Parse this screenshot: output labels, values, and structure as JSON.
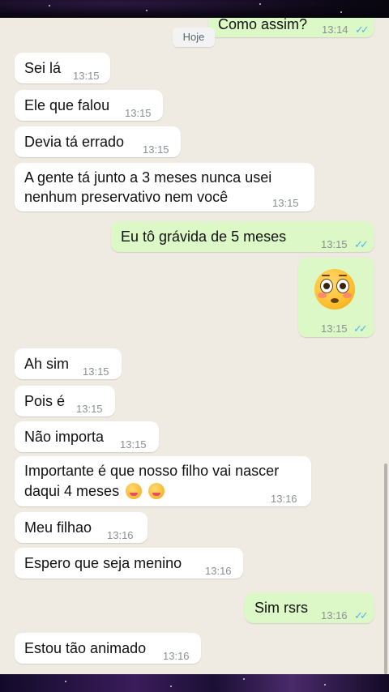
{
  "top_partial": {
    "text": "Como assim?",
    "time": "13:14",
    "status": "read"
  },
  "date_separator": "Hoje",
  "messages": [
    {
      "dir": "in",
      "lines": [
        "Sei lá"
      ],
      "time": "13:15"
    },
    {
      "dir": "in",
      "lines": [
        "Ele que falou"
      ],
      "time": "13:15"
    },
    {
      "dir": "in",
      "lines": [
        "Devia tá errado"
      ],
      "time": "13:15"
    },
    {
      "dir": "in",
      "lines": [
        "A gente tá junto a 3 meses nunca usei",
        "nenhum preservativo nem você"
      ],
      "time": "13:15"
    },
    {
      "dir": "out",
      "lines": [
        "Eu tô grávida de 5 meses"
      ],
      "time": "13:15",
      "status": "read"
    },
    {
      "dir": "out",
      "emoji": "flushed-face-emoji",
      "time": "13:15",
      "status": "read"
    },
    {
      "dir": "in",
      "lines": [
        "Ah sim"
      ],
      "time": "13:15"
    },
    {
      "dir": "in",
      "lines": [
        "Pois é"
      ],
      "time": "13:15"
    },
    {
      "dir": "in",
      "lines": [
        "Não importa"
      ],
      "time": "13:15"
    },
    {
      "dir": "in",
      "lines": [
        "Importante é que nosso filho vai nascer",
        "daqui 4 meses"
      ],
      "emoji_suffix": "smiling-face-with-hearts-emoji x2",
      "time": "13:16"
    },
    {
      "dir": "in",
      "lines": [
        "Meu filhao"
      ],
      "time": "13:16"
    },
    {
      "dir": "in",
      "lines": [
        "Espero que seja menino"
      ],
      "time": "13:16"
    },
    {
      "dir": "out",
      "lines": [
        "Sim rsrs"
      ],
      "time": "13:16",
      "status": "read"
    },
    {
      "dir": "in",
      "lines": [
        "Estou tão animado"
      ],
      "time": "13:16"
    }
  ],
  "colors": {
    "chat_background": "#efeae2",
    "incoming_bubble": "#ffffff",
    "outgoing_bubble": "#dcf8c6",
    "read_checks": "#4fb6ec",
    "timestamp": "#8a8f93"
  }
}
